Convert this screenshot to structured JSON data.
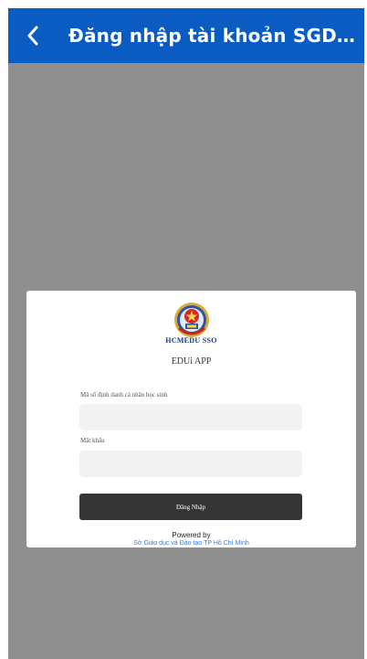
{
  "header": {
    "title": "Đăng nhập tài khoản SGD&ĐT ...",
    "back_icon": "chevron-left-icon",
    "background": "#0a5bc2"
  },
  "login_card": {
    "logo_icon": "hcmedu-emblem-icon",
    "brand": "HCMEDU SSO",
    "app_name": "EDUi APP",
    "student_id": {
      "label": "Mã số định danh cá nhân học sinh",
      "value": ""
    },
    "password": {
      "label": "Mật khẩu",
      "value": ""
    },
    "login_button": "Đăng Nhập",
    "powered_by": "Powered by",
    "organization": "Sở Giáo dục và Đào tạo TP Hồ Chí Minh",
    "link_color": "#3a7bd5",
    "button_color": "#353535"
  }
}
